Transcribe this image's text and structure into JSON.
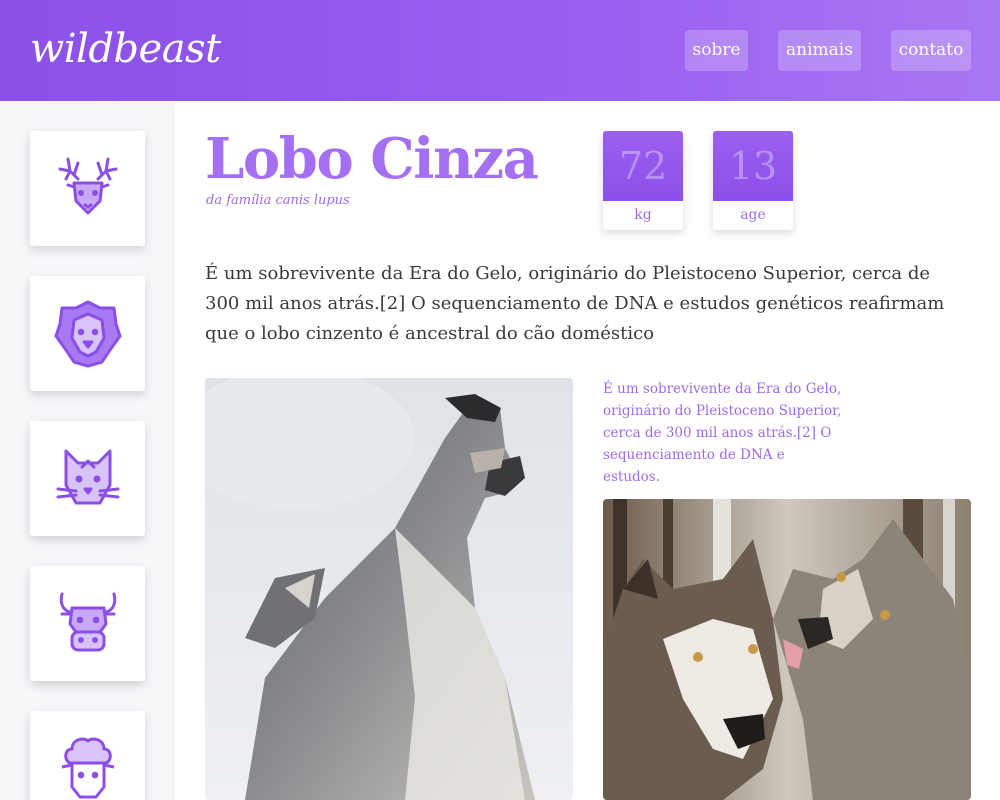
{
  "header": {
    "logo": "wildbeast",
    "nav": [
      {
        "label": "sobre"
      },
      {
        "label": "animais"
      },
      {
        "label": "contato"
      }
    ]
  },
  "sidebar": {
    "animals": [
      {
        "icon": "deer-icon"
      },
      {
        "icon": "lion-icon"
      },
      {
        "icon": "cat-icon"
      },
      {
        "icon": "bull-icon"
      },
      {
        "icon": "sheep-icon"
      }
    ]
  },
  "animal": {
    "name": "Lobo Cinza",
    "family": "da família canis lupus",
    "stats": [
      {
        "value": "72",
        "label": "kg"
      },
      {
        "value": "13",
        "label": "age"
      }
    ],
    "description": "É um sobrevivente da Era do Gelo, originário do Pleistoceno Superior, cerca de 300 mil anos atrás.[2] O sequenciamento de DNA e estudos genéticos reafirmam que o lobo cinzento é ancestral do cão doméstico",
    "caption": "É um sobrevivente da Era do Gelo, originário do Pleistoceno Superior, cerca de 300 mil anos atrás.[2] O sequenciamento de DNA e estudos.",
    "photos": [
      {
        "subject": "howling-wolf-photo"
      },
      {
        "subject": "wolf-pair-photo"
      }
    ]
  },
  "colors": {
    "brand": "#8a50e8",
    "accent": "#a46ff2",
    "caption": "#9c6be8"
  }
}
